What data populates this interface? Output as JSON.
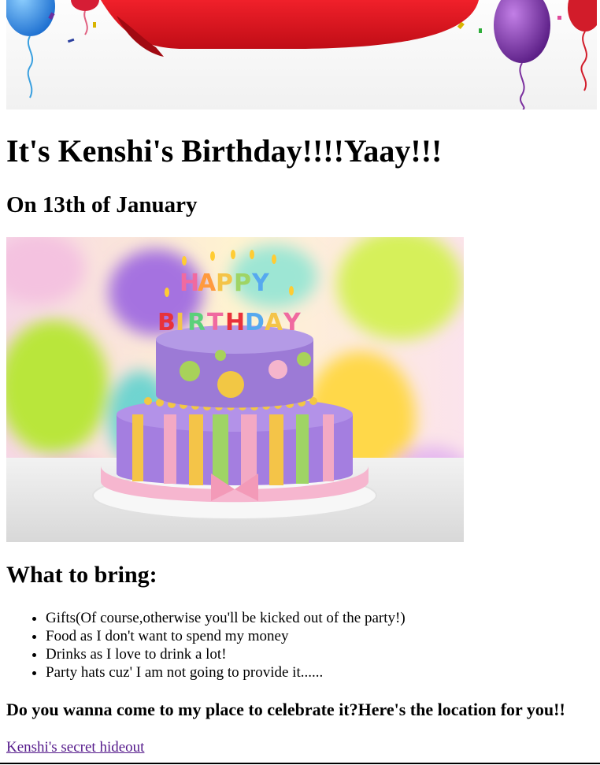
{
  "banner": {
    "image_name": "birthday-banner-image",
    "ribbon_color": "#e0121b",
    "balloon_colors": [
      "#2a8fe0",
      "#7a2f9e",
      "#d21c2a"
    ]
  },
  "heading": "It's Kenshi's Birthday!!!!Yaay!!!",
  "date_heading": "On 13th of January",
  "cake_image": {
    "image_name": "birthday-cake-image",
    "candle_text": [
      "HAPPY",
      "BIRTHDAY"
    ]
  },
  "bring_heading": "What to bring:",
  "bring_items": [
    "Gifts(Of course,otherwise you'll be kicked out of the party!)",
    "Food as I don't want to spend my money",
    "Drinks as I love to drink a lot!",
    "Party hats cuz' I am not going to provide it......"
  ],
  "invite_text": "Do you wanna come to my place to celebrate it?Here's the location for you!!",
  "location_link": "Kenshi's secret hideout",
  "colors": {
    "link": "#551a8b",
    "text": "#000000"
  }
}
